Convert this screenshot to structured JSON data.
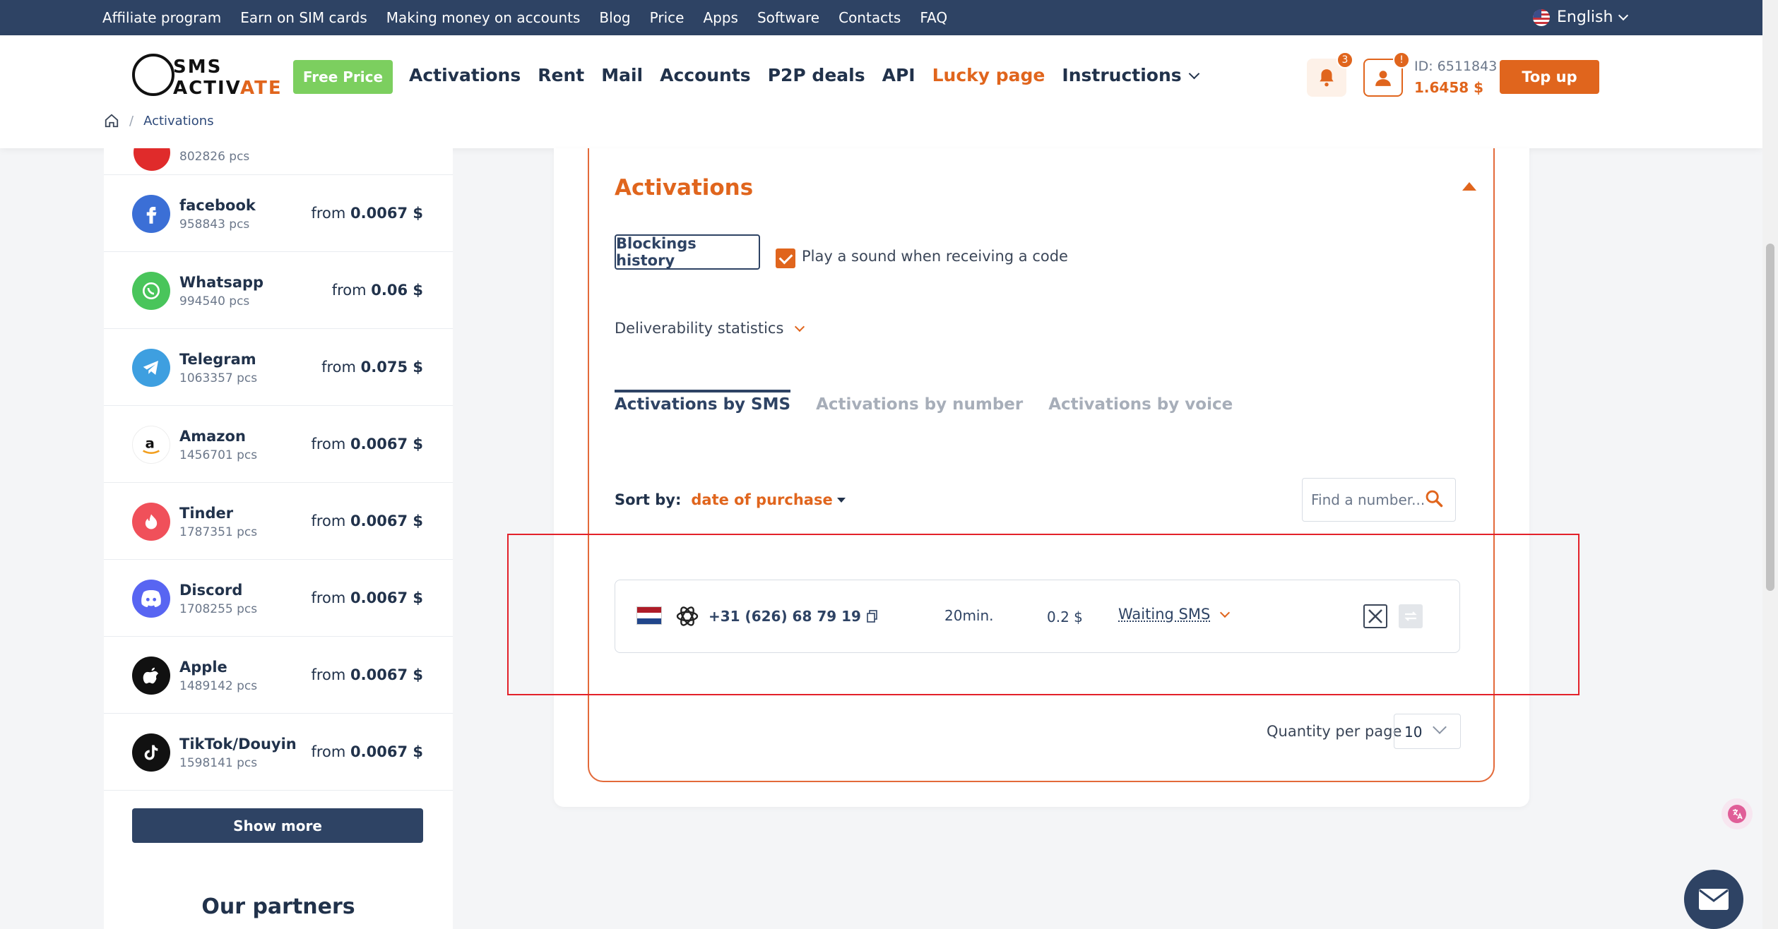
{
  "topbar": {
    "links": [
      "Affiliate program",
      "Earn on SIM cards",
      "Making money on accounts",
      "Blog",
      "Price",
      "Apps",
      "Software",
      "Contacts",
      "FAQ"
    ],
    "language": "English"
  },
  "header": {
    "logo_line1": "SMS",
    "logo_line2a": "ACTIV",
    "logo_line2b": "ATE",
    "free_price_label": "Free Price",
    "nav": [
      "Activations",
      "Rent",
      "Mail",
      "Accounts",
      "P2P deals",
      "API",
      "Lucky page",
      "Instructions"
    ],
    "notifications_count": "3",
    "profile_badge": "!",
    "account_id": "ID: 6511843",
    "balance": "1.6458 $",
    "topup_label": "Top up"
  },
  "breadcrumb": {
    "separator": "/",
    "current": "Activations"
  },
  "sidebar": {
    "partial_top_pcs": "802826 pcs",
    "services": [
      {
        "name": "facebook",
        "pcs": "958843 pcs",
        "from": "from",
        "price": "0.0067 $",
        "icon": "facebook-icon",
        "color": "#3b6fd6"
      },
      {
        "name": "Whatsapp",
        "pcs": "994540 pcs",
        "from": "from",
        "price": "0.06 $",
        "icon": "whatsapp-icon",
        "color": "#49c55b"
      },
      {
        "name": "Telegram",
        "pcs": "1063357 pcs",
        "from": "from",
        "price": "0.075 $",
        "icon": "telegram-icon",
        "color": "#3e9fe0"
      },
      {
        "name": "Amazon",
        "pcs": "1456701 pcs",
        "from": "from",
        "price": "0.0067 $",
        "icon": "amazon-icon",
        "color": "#ffffff"
      },
      {
        "name": "Tinder",
        "pcs": "1787351 pcs",
        "from": "from",
        "price": "0.0067 $",
        "icon": "tinder-icon",
        "color": "#f0505a"
      },
      {
        "name": "Discord",
        "pcs": "1708255 pcs",
        "from": "from",
        "price": "0.0067 $",
        "icon": "discord-icon",
        "color": "#5865f2"
      },
      {
        "name": "Apple",
        "pcs": "1489142 pcs",
        "from": "from",
        "price": "0.0067 $",
        "icon": "apple-icon",
        "color": "#111111"
      },
      {
        "name": "TikTok/Douyin",
        "pcs": "1598141 pcs",
        "from": "from",
        "price": "0.0067 $",
        "icon": "tiktok-icon",
        "color": "#111111"
      }
    ],
    "show_more_label": "Show more",
    "partners_title": "Our partners"
  },
  "activations": {
    "title": "Activations",
    "blockings_label": "Blockings history",
    "sound_label": "Play a sound when receiving a code",
    "sound_checked": true,
    "deliverability_label": "Deliverability statistics",
    "tabs": [
      "Activations by SMS",
      "Activations by number",
      "Activations by voice"
    ],
    "active_tab": 0,
    "sort_label": "Sort by:",
    "sort_value": "date of purchase",
    "search_placeholder": "Find a number...",
    "rows": [
      {
        "country_flag": "netherlands-flag",
        "service_icon": "openai-icon",
        "phone": "+31 (626) 68 79 19",
        "time": "20min.",
        "price": "0.2 $",
        "status": "Waiting SMS"
      }
    ],
    "quantity_label": "Quantity per page",
    "quantity_value": "10"
  },
  "colors": {
    "accent": "#e0651d",
    "navy": "#2e4364",
    "green": "#7ccf5f",
    "highlight_red": "#e3212a"
  }
}
